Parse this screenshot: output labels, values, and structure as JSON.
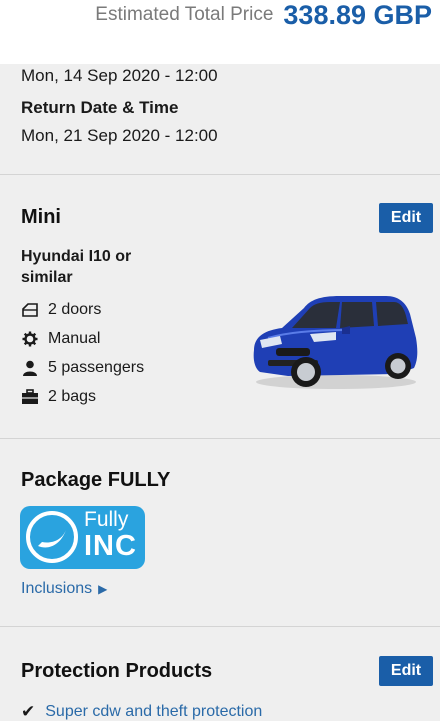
{
  "header": {
    "price_label": "Estimated Total Price",
    "price_value": "338.89 GBP"
  },
  "dates": {
    "pickup_value": "Mon, 14 Sep 2020 - 12:00",
    "return_label": "Return Date & Time",
    "return_value": "Mon, 21 Sep 2020 - 12:00"
  },
  "vehicle": {
    "category": "Mini",
    "edit_label": "Edit",
    "model": "Hyundai I10 or similar",
    "features": [
      {
        "icon": "door-icon",
        "label": "2 doors"
      },
      {
        "icon": "gear-icon",
        "label": "Manual"
      },
      {
        "icon": "person-icon",
        "label": "5 passengers"
      },
      {
        "icon": "luggage-icon",
        "label": "2 bags"
      }
    ],
    "image": "blue hatchback car"
  },
  "package": {
    "title": "Package FULLY",
    "badge_line1": "Fully",
    "badge_line2": "INC",
    "inclusions_label": "Inclusions"
  },
  "protection": {
    "title": "Protection Products",
    "edit_label": "Edit",
    "items": [
      "Super cdw and theft protection"
    ]
  },
  "colors": {
    "accent": "#1a5ea8",
    "link": "#2a6aa8",
    "badge": "#2aa3df",
    "background": "#efefef"
  }
}
